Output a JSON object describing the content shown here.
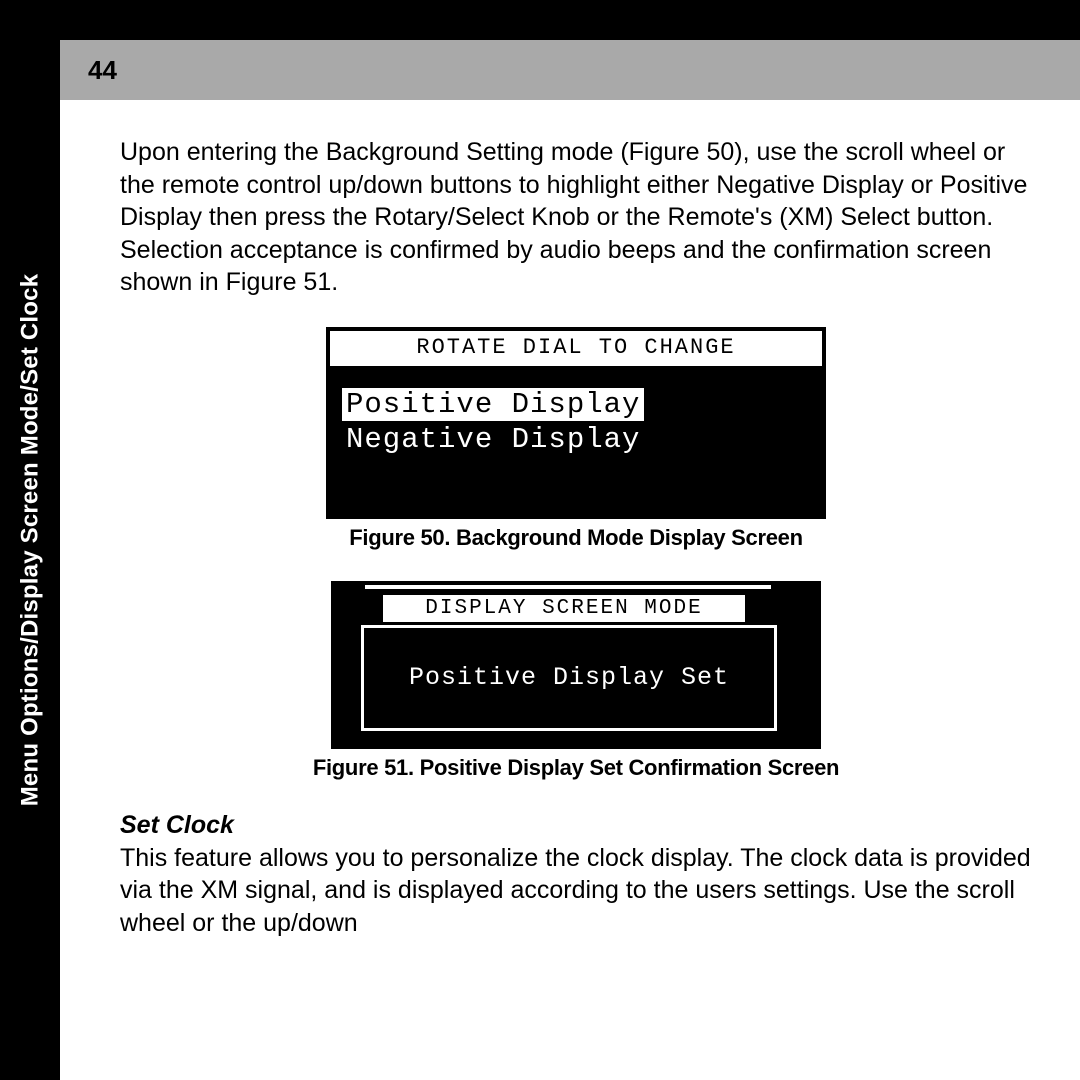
{
  "sidebar": {
    "title": "Menu Options/Display Screen Mode/Set Clock"
  },
  "header": {
    "page_number": "44"
  },
  "paragraph1": "Upon entering the Background Setting mode (Figure 50), use the scroll wheel or the remote control up/down buttons to highlight either Negative Display or Positive Display then press the Rotary/Select Knob or the Remote's (XM) Select button. Selection acceptance is confirmed by audio beeps and the confirmation screen shown in Figure 51.",
  "figure50": {
    "header": "ROTATE DIAL TO CHANGE",
    "option_selected": "Positive Display",
    "option_unselected": "Negative Display",
    "caption": "Figure 50. Background Mode Display Screen"
  },
  "figure51": {
    "header": "DISPLAY SCREEN MODE",
    "body": "Positive Display Set",
    "caption": "Figure 51. Positive Display Set Confirmation Screen"
  },
  "section_heading": "Set Clock",
  "paragraph2": "This feature allows you to personalize the clock display.  The clock data is provided via the XM signal, and is displayed according to the users settings. Use the scroll wheel or the up/down"
}
